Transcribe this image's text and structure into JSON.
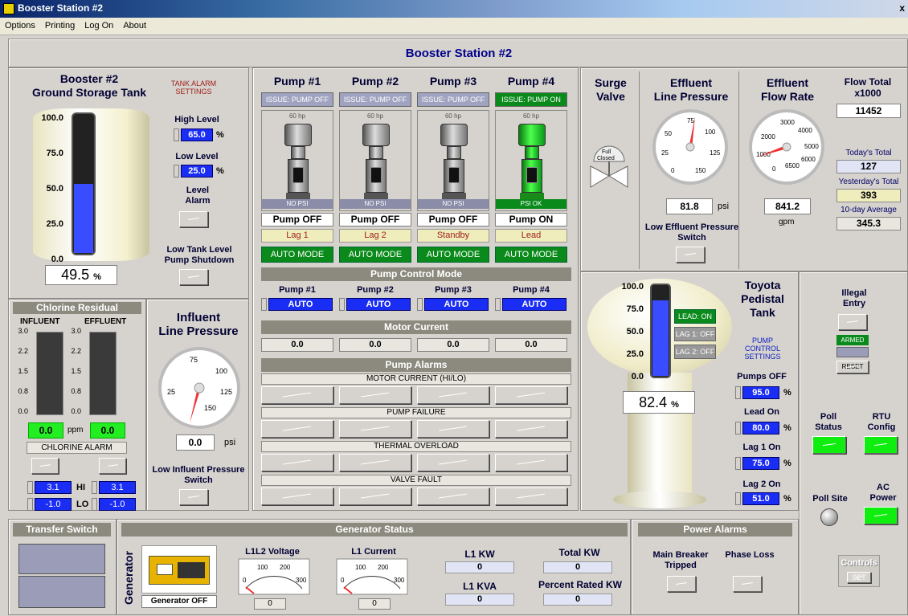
{
  "window": {
    "title": "Booster Station #2",
    "close": "x"
  },
  "menu": [
    "Options",
    "Printing",
    "Log On",
    "About"
  ],
  "main_title": "Booster Station #2",
  "storage_tank": {
    "title1": "Booster #2",
    "title2": "Ground Storage Tank",
    "scale": [
      "100.0",
      "75.0",
      "50.0",
      "25.0",
      "0.0"
    ],
    "level_fraction": 0.495,
    "value": "49.5",
    "unit": "%",
    "alarm_settings": "TANK ALARM SETTINGS",
    "high_label": "High Level",
    "high_value": "65.0",
    "low_label": "Low Level",
    "low_value": "25.0",
    "pct": "%",
    "level_alarm": "Level Alarm",
    "shutdown": "Low Tank Level Pump Shutdown"
  },
  "chlorine": {
    "title": "Chlorine Residual",
    "influent": "INFLUENT",
    "effluent": "EFFLUENT",
    "scale": [
      "3.0",
      "2.2",
      "1.5",
      "0.8",
      "0.0"
    ],
    "influent_value": "0.0",
    "effluent_value": "0.0",
    "unit": "ppm",
    "alarm": "CHLORINE ALARM",
    "hi_label": "HI",
    "lo_label": "LO",
    "hi1": "3.1",
    "lo1": "-1.0",
    "hi2": "3.1",
    "lo2": "-1.0"
  },
  "influent_pressure": {
    "title1": "Influent",
    "title2": "Line Pressure",
    "ticks": [
      "25",
      "75",
      "100",
      "125",
      "150"
    ],
    "value": "0.0",
    "unit": "psi",
    "switch": "Low Influent Pressure Switch"
  },
  "pumps": [
    {
      "name": "Pump #1",
      "issue": "ISSUE: PUMP OFF",
      "hp": "60 hp",
      "psi": "NO PSI",
      "status": "Pump OFF",
      "role": "Lag 1",
      "mode": "AUTO MODE",
      "ctrl": "AUTO",
      "current": "0.0",
      "on": false
    },
    {
      "name": "Pump #2",
      "issue": "ISSUE: PUMP OFF",
      "hp": "60 hp",
      "psi": "NO PSI",
      "status": "Pump OFF",
      "role": "Lag 2",
      "mode": "AUTO MODE",
      "ctrl": "AUTO",
      "current": "0.0",
      "on": false
    },
    {
      "name": "Pump #3",
      "issue": "ISSUE: PUMP OFF",
      "hp": "60 hp",
      "psi": "NO PSI",
      "status": "Pump OFF",
      "role": "Standby",
      "mode": "AUTO MODE",
      "ctrl": "AUTO",
      "current": "0.0",
      "on": false
    },
    {
      "name": "Pump #4",
      "issue": "ISSUE: PUMP ON",
      "hp": "60 hp",
      "psi": "PSI OK",
      "status": "Pump ON",
      "role": "Lead",
      "mode": "AUTO MODE",
      "ctrl": "AUTO",
      "current": "0.0",
      "on": true
    }
  ],
  "pump_control_mode": "Pump Control Mode",
  "motor_current": "Motor Current",
  "pump_alarms": {
    "title": "Pump Alarms",
    "rows": [
      "MOTOR CURRENT (HI/LO)",
      "PUMP FAILURE",
      "THERMAL OVERLOAD",
      "VALVE FAULT"
    ]
  },
  "surge": {
    "title1": "Surge",
    "title2": "Valve",
    "state": "Full Closed"
  },
  "effluent_pressure": {
    "title1": "Effluent",
    "title2": "Line Pressure",
    "ticks": [
      "25",
      "50",
      "75",
      "100",
      "125",
      "150",
      "0"
    ],
    "value": "81.8",
    "unit": "psi",
    "switch": "Low Effluent Pressure Switch"
  },
  "effluent_flow": {
    "title1": "Effluent",
    "title2": "Flow Rate",
    "ticks": [
      "1000",
      "2000",
      "3000",
      "4000",
      "5000",
      "6000",
      "6500",
      "0"
    ],
    "value": "841.2",
    "unit": "gpm"
  },
  "flow_total": {
    "title1": "Flow Total",
    "title2": "x1000",
    "value": "11452",
    "today_label": "Today's Total",
    "today": "127",
    "yesterday_label": "Yesterday's Total",
    "yesterday": "393",
    "avg_label": "10-day Average",
    "avg": "345.3"
  },
  "toyota": {
    "title1": "Toyota",
    "title2": "Pedistal",
    "title3": "Tank",
    "scale": [
      "100.0",
      "75.0",
      "50.0",
      "25.0",
      "0.0"
    ],
    "level_fraction": 0.824,
    "value": "82.4",
    "unit": "%",
    "lead": "LEAD: ON",
    "lag1": "LAG 1: OFF",
    "lag2": "LAG 2: OFF",
    "settings": "PUMP CONTROL SETTINGS",
    "pumps_off_label": "Pumps OFF",
    "pumps_off": "95.0",
    "lead_on_label": "Lead On",
    "lead_on": "80.0",
    "lag1_on_label": "Lag 1 On",
    "lag1_on": "75.0",
    "lag2_on_label": "Lag 2 On",
    "lag2_on": "51.0",
    "pct": "%"
  },
  "illegal": {
    "title1": "Illegal",
    "title2": "Entry",
    "armed": "ARMED",
    "reset": "RESET"
  },
  "poll_status": {
    "title1": "Poll",
    "title2": "Status"
  },
  "rtu": {
    "title1": "RTU",
    "title2": "Config"
  },
  "poll_site": "Poll Site",
  "ac_power": {
    "title1": "AC",
    "title2": "Power"
  },
  "transfer": "Transfer Switch",
  "generator": {
    "title": "Generator Status",
    "side": "Generator",
    "state": "Generator OFF",
    "voltage_label": "L1L2 Voltage",
    "voltage": "0",
    "current_label": "L1 Current",
    "current": "0",
    "meter_ticks": [
      "0",
      "100",
      "200",
      "300"
    ],
    "kw_label": "L1 KW",
    "kw": "0",
    "kva_label": "L1 KVA",
    "kva": "0",
    "total_label": "Total KW",
    "total": "0",
    "pct_label": "Percent Rated KW",
    "pct": "0"
  },
  "power_alarms": {
    "title": "Power Alarms",
    "breaker": "Main Breaker Tripped",
    "phase": "Phase Loss"
  },
  "controls": {
    "title": "Controls",
    "set": "SET"
  }
}
